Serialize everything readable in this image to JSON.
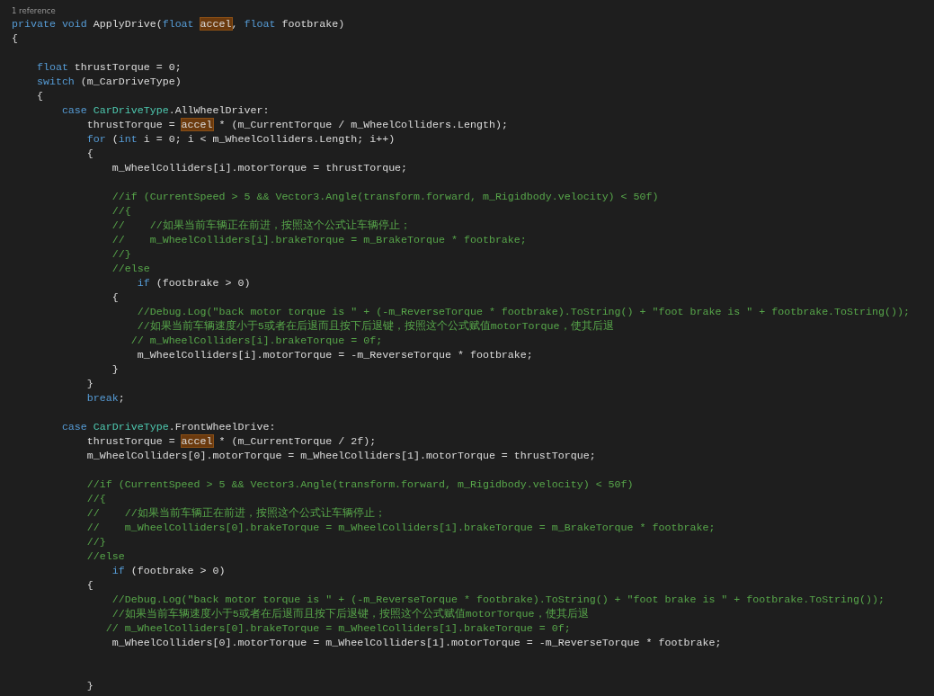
{
  "editor": {
    "codelens": "1 reference",
    "lines": [
      {
        "kind": "code",
        "tokens": [
          {
            "kind": "kw",
            "text": "private void"
          },
          {
            "kind": "plain",
            "text": " ApplyDrive("
          },
          {
            "kind": "kw",
            "text": "float "
          },
          {
            "kind": "ref",
            "text": "accel"
          },
          {
            "kind": "plain",
            "text": ", "
          },
          {
            "kind": "kw",
            "text": "float"
          },
          {
            "kind": "plain",
            "text": " footbrake)"
          }
        ]
      },
      {
        "kind": "code",
        "tokens": [
          {
            "kind": "plain",
            "text": "{"
          }
        ]
      },
      {
        "kind": "blank"
      },
      {
        "kind": "code",
        "tokens": [
          {
            "kind": "kw",
            "text": "    float"
          },
          {
            "kind": "plain",
            "text": " thrustTorque = 0;"
          }
        ]
      },
      {
        "kind": "code",
        "tokens": [
          {
            "kind": "kw",
            "text": "    switch"
          },
          {
            "kind": "plain",
            "text": " (m_CarDriveType)"
          }
        ]
      },
      {
        "kind": "code",
        "tokens": [
          {
            "kind": "plain",
            "text": "    {"
          }
        ]
      },
      {
        "kind": "code",
        "tokens": [
          {
            "kind": "kw",
            "text": "        case "
          },
          {
            "kind": "type",
            "text": "CarDriveType"
          },
          {
            "kind": "plain",
            "text": ".AllWheelDriver:"
          }
        ]
      },
      {
        "kind": "code",
        "tokens": [
          {
            "kind": "plain",
            "text": "            thrustTorque = "
          },
          {
            "kind": "ref",
            "text": "accel"
          },
          {
            "kind": "plain",
            "text": " * (m_CurrentTorque / m_WheelColliders.Length);"
          }
        ]
      },
      {
        "kind": "code",
        "tokens": [
          {
            "kind": "kw",
            "text": "            for"
          },
          {
            "kind": "plain",
            "text": " ("
          },
          {
            "kind": "kw",
            "text": "int"
          },
          {
            "kind": "plain",
            "text": " i = 0; i < m_WheelColliders.Length; i++)"
          }
        ]
      },
      {
        "kind": "code",
        "tokens": [
          {
            "kind": "plain",
            "text": "            {"
          }
        ]
      },
      {
        "kind": "code",
        "tokens": [
          {
            "kind": "plain",
            "text": "                m_WheelColliders[i].motorTorque = thrustTorque;"
          }
        ]
      },
      {
        "kind": "blank"
      },
      {
        "kind": "code",
        "tokens": [
          {
            "kind": "comment",
            "text": "                //if (CurrentSpeed > 5 && Vector3.Angle(transform.forward, m_Rigidbody.velocity) < 50f)"
          }
        ]
      },
      {
        "kind": "code",
        "tokens": [
          {
            "kind": "comment",
            "text": "                //{"
          }
        ]
      },
      {
        "kind": "code",
        "tokens": [
          {
            "kind": "comment",
            "text": "                //    //如果当前车辆正在前进，按照这个公式让车辆停止；"
          }
        ]
      },
      {
        "kind": "code",
        "tokens": [
          {
            "kind": "comment",
            "text": "                //    m_WheelColliders[i].brakeTorque = m_BrakeTorque * footbrake;"
          }
        ]
      },
      {
        "kind": "code",
        "tokens": [
          {
            "kind": "comment",
            "text": "                //}"
          }
        ]
      },
      {
        "kind": "code",
        "tokens": [
          {
            "kind": "comment",
            "text": "                //else"
          }
        ]
      },
      {
        "kind": "code",
        "tokens": [
          {
            "kind": "kw",
            "text": "                    if"
          },
          {
            "kind": "plain",
            "text": " (footbrake > 0)"
          }
        ]
      },
      {
        "kind": "code",
        "tokens": [
          {
            "kind": "plain",
            "text": "                {"
          }
        ]
      },
      {
        "kind": "code",
        "tokens": [
          {
            "kind": "comment",
            "text": "                    //Debug.Log(\"back motor torque is \" + (-m_ReverseTorque * footbrake).ToString() + \"foot brake is \" + footbrake.ToString());"
          }
        ]
      },
      {
        "kind": "code",
        "tokens": [
          {
            "kind": "comment",
            "text": "                    //如果当前车辆速度小于5或者在后退而且按下后退键，按照这个公式赋值motorTorque，使其后退"
          }
        ]
      },
      {
        "kind": "code",
        "tokens": [
          {
            "kind": "comment",
            "text": "                   // m_WheelColliders[i].brakeTorque = 0f;"
          }
        ]
      },
      {
        "kind": "code",
        "tokens": [
          {
            "kind": "plain",
            "text": "                    m_WheelColliders[i].motorTorque = -m_ReverseTorque * footbrake;"
          }
        ]
      },
      {
        "kind": "code",
        "tokens": [
          {
            "kind": "plain",
            "text": "                }"
          }
        ]
      },
      {
        "kind": "code",
        "tokens": [
          {
            "kind": "plain",
            "text": "            }"
          }
        ]
      },
      {
        "kind": "code",
        "tokens": [
          {
            "kind": "kw",
            "text": "            break"
          },
          {
            "kind": "plain",
            "text": ";"
          }
        ]
      },
      {
        "kind": "blank"
      },
      {
        "kind": "code",
        "tokens": [
          {
            "kind": "kw",
            "text": "        case "
          },
          {
            "kind": "type",
            "text": "CarDriveType"
          },
          {
            "kind": "plain",
            "text": ".FrontWheelDrive:"
          }
        ]
      },
      {
        "kind": "code",
        "tokens": [
          {
            "kind": "plain",
            "text": "            thrustTorque = "
          },
          {
            "kind": "ref",
            "text": "accel"
          },
          {
            "kind": "plain",
            "text": " * (m_CurrentTorque / 2f);"
          }
        ]
      },
      {
        "kind": "code",
        "tokens": [
          {
            "kind": "plain",
            "text": "            m_WheelColliders[0].motorTorque = m_WheelColliders[1].motorTorque = thrustTorque;"
          }
        ]
      },
      {
        "kind": "blank"
      },
      {
        "kind": "code",
        "tokens": [
          {
            "kind": "comment",
            "text": "            //if (CurrentSpeed > 5 && Vector3.Angle(transform.forward, m_Rigidbody.velocity) < 50f)"
          }
        ]
      },
      {
        "kind": "code",
        "tokens": [
          {
            "kind": "comment",
            "text": "            //{"
          }
        ]
      },
      {
        "kind": "code",
        "tokens": [
          {
            "kind": "comment",
            "text": "            //    //如果当前车辆正在前进，按照这个公式让车辆停止；"
          }
        ]
      },
      {
        "kind": "code",
        "tokens": [
          {
            "kind": "comment",
            "text": "            //    m_WheelColliders[0].brakeTorque = m_WheelColliders[1].brakeTorque = m_BrakeTorque * footbrake;"
          }
        ]
      },
      {
        "kind": "code",
        "tokens": [
          {
            "kind": "comment",
            "text": "            //}"
          }
        ]
      },
      {
        "kind": "code",
        "tokens": [
          {
            "kind": "comment",
            "text": "            //else"
          }
        ]
      },
      {
        "kind": "code",
        "tokens": [
          {
            "kind": "kw",
            "text": "                if"
          },
          {
            "kind": "plain",
            "text": " (footbrake > 0)"
          }
        ]
      },
      {
        "kind": "code",
        "tokens": [
          {
            "kind": "plain",
            "text": "            {"
          }
        ]
      },
      {
        "kind": "code",
        "tokens": [
          {
            "kind": "comment",
            "text": "                //Debug.Log(\"back motor torque is \" + (-m_ReverseTorque * footbrake).ToString() + \"foot brake is \" + footbrake.ToString());"
          }
        ]
      },
      {
        "kind": "code",
        "tokens": [
          {
            "kind": "comment",
            "text": "                //如果当前车辆速度小于5或者在后退而且按下后退键，按照这个公式赋值motorTorque，使其后退"
          }
        ]
      },
      {
        "kind": "code",
        "tokens": [
          {
            "kind": "comment",
            "text": "               // m_WheelColliders[0].brakeTorque = m_WheelColliders[1].brakeTorque = 0f;"
          }
        ]
      },
      {
        "kind": "code",
        "tokens": [
          {
            "kind": "plain",
            "text": "                m_WheelColliders[0].motorTorque = m_WheelColliders[1].motorTorque = -m_ReverseTorque * footbrake;"
          }
        ]
      },
      {
        "kind": "blank"
      },
      {
        "kind": "blank"
      },
      {
        "kind": "code",
        "tokens": [
          {
            "kind": "plain",
            "text": "            }"
          }
        ]
      }
    ]
  }
}
